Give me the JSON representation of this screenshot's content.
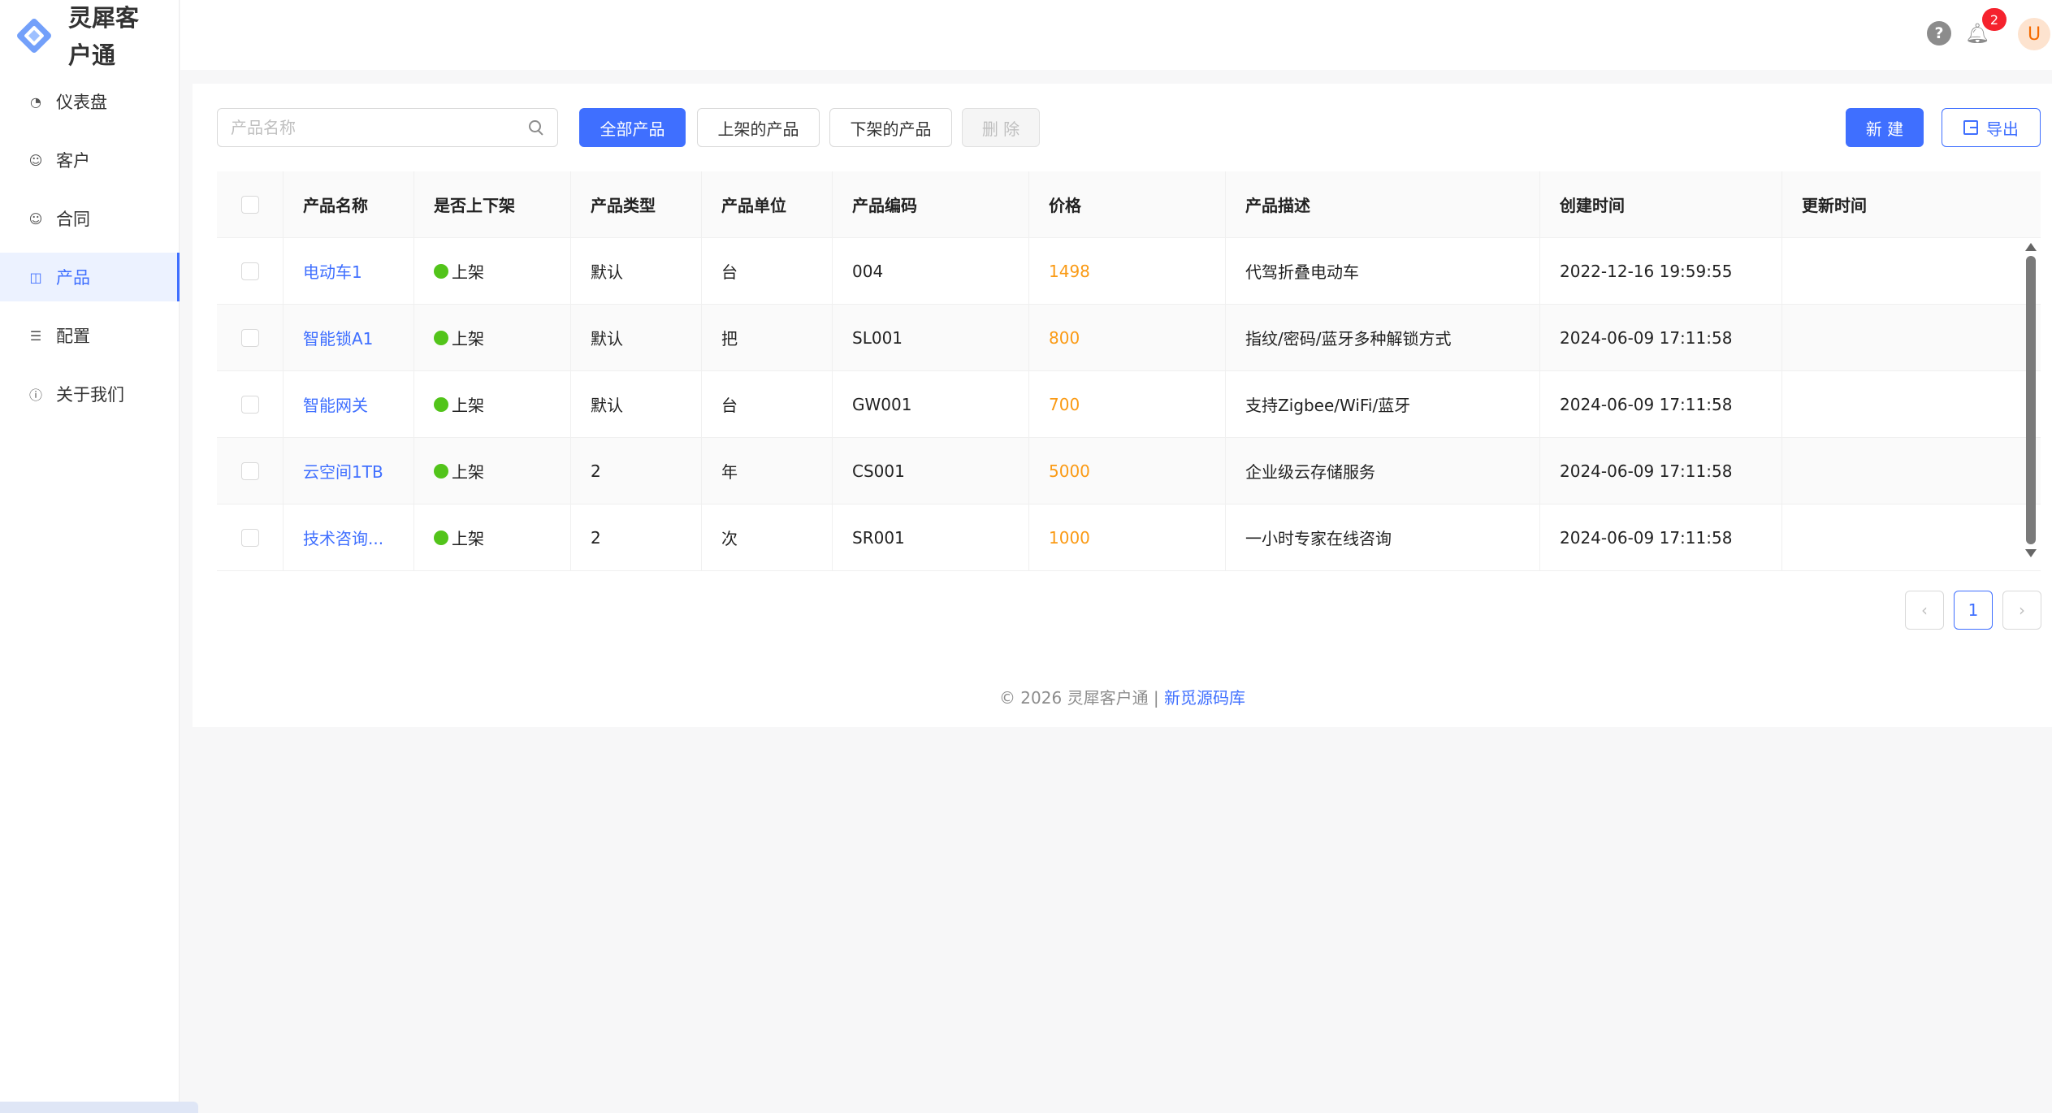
{
  "app": {
    "name": "灵犀客户通"
  },
  "sidebar": {
    "items": [
      {
        "label": "仪表盘",
        "icon": "dashboard-icon"
      },
      {
        "label": "客户",
        "icon": "smile-icon"
      },
      {
        "label": "合同",
        "icon": "smile-icon"
      },
      {
        "label": "产品",
        "icon": "shopping-bag-icon",
        "active": true
      },
      {
        "label": "配置",
        "icon": "list-icon"
      },
      {
        "label": "关于我们",
        "icon": "info-icon"
      }
    ]
  },
  "header": {
    "help_label": "?",
    "notifications": "2",
    "avatar": "U"
  },
  "toolbar": {
    "search_placeholder": "产品名称",
    "all_label": "全部产品",
    "on_label": "上架的产品",
    "off_label": "下架的产品",
    "delete_label": "删 除",
    "new_label": "新 建",
    "export_label": "导出"
  },
  "table": {
    "columns": [
      "产品名称",
      "是否上下架",
      "产品类型",
      "产品单位",
      "产品编码",
      "价格",
      "产品描述",
      "创建时间",
      "更新时间"
    ],
    "rows": [
      {
        "name": "电动车1",
        "status": "上架",
        "type": "默认",
        "unit": "台",
        "code": "004",
        "price": "1498",
        "desc": "代驾折叠电动车",
        "created": "2022-12-16 19:59:55",
        "updated": ""
      },
      {
        "name": "智能锁A1",
        "status": "上架",
        "type": "默认",
        "unit": "把",
        "code": "SL001",
        "price": "800",
        "desc": "指纹/密码/蓝牙多种解锁方式",
        "created": "2024-06-09 17:11:58",
        "updated": ""
      },
      {
        "name": "智能网关",
        "status": "上架",
        "type": "默认",
        "unit": "台",
        "code": "GW001",
        "price": "700",
        "desc": "支持Zigbee/WiFi/蓝牙",
        "created": "2024-06-09 17:11:58",
        "updated": ""
      },
      {
        "name": "云空间1TB",
        "status": "上架",
        "type": "2",
        "unit": "年",
        "code": "CS001",
        "price": "5000",
        "desc": "企业级云存储服务",
        "created": "2024-06-09 17:11:58",
        "updated": ""
      },
      {
        "name": "技术咨询...",
        "status": "上架",
        "type": "2",
        "unit": "次",
        "code": "SR001",
        "price": "1000",
        "desc": "一小时专家在线咨询",
        "created": "2024-06-09 17:11:58",
        "updated": ""
      }
    ]
  },
  "pagination": {
    "prev": "‹",
    "current": "1",
    "next": "›"
  },
  "footer": {
    "copyright": "© 2026 灵犀客户通 | ",
    "link": "新觅源码库"
  },
  "colors": {
    "accent": "#3f6fff",
    "price": "#fa9a14",
    "status_on": "#52c41a"
  }
}
